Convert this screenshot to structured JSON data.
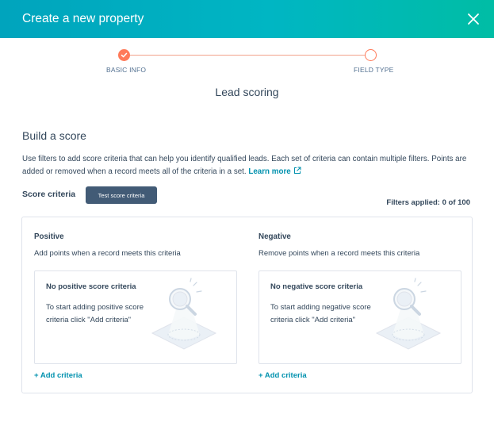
{
  "header": {
    "title": "Create a new property",
    "close_icon": "close-icon",
    "gradient_colors": [
      "#00a4bd",
      "#00bda5"
    ]
  },
  "stepper": {
    "steps": [
      {
        "label": "BASIC INFO",
        "state": "complete"
      },
      {
        "label": "FIELD TYPE",
        "state": "incomplete"
      }
    ],
    "accent_color": "#ff7a59"
  },
  "page": {
    "heading": "Lead scoring"
  },
  "build": {
    "title": "Build a score",
    "description": "Use filters to add score criteria that can help you identify qualified leads. Each set of criteria can contain multiple filters. Points are added or removed when a record meets all of the criteria in a set.",
    "learn_more": "Learn more",
    "external_icon": "external-link-icon"
  },
  "criteria": {
    "label": "Score criteria",
    "test_button": "Test score criteria",
    "filters_applied": "Filters applied: 0 of 100"
  },
  "positive": {
    "title": "Positive",
    "description": "Add points when a record meets this criteria",
    "empty_title": "No positive score criteria",
    "empty_body": "To start adding positive score criteria click \"Add criteria\"",
    "add_link": "+ Add criteria"
  },
  "negative": {
    "title": "Negative",
    "description": "Remove points when a record meets this criteria",
    "empty_title": "No negative score criteria",
    "empty_body": "To start adding negative score criteria click \"Add criteria\"",
    "add_link": "+ Add criteria"
  },
  "colors": {
    "text": "#33475b",
    "link": "#0091ae",
    "button": "#425b76",
    "border": "#dfe3eb"
  }
}
